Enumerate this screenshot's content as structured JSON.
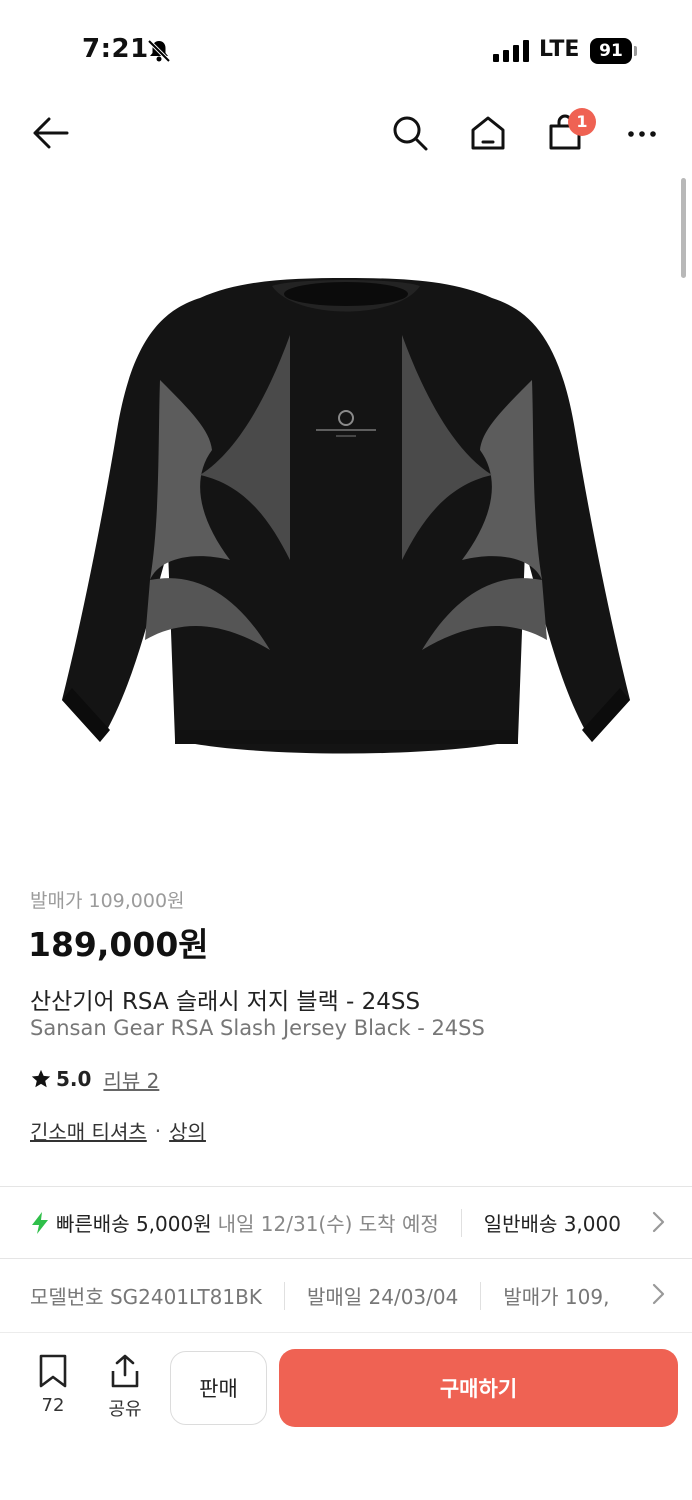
{
  "status_bar": {
    "time": "7:21",
    "network": "LTE",
    "battery": "91",
    "icons": [
      "bell-slash-icon",
      "signal-icon",
      "battery-icon"
    ]
  },
  "nav": {
    "icons": [
      "back-arrow-icon",
      "search-icon",
      "home-icon",
      "shopping-bag-icon",
      "more-icon"
    ],
    "cart_badge": "1"
  },
  "product": {
    "image_desc_icon": "product-jersey-image",
    "release_price": "발매가 109,000원",
    "price": "189,000원",
    "title_ko": "산산기어 RSA 슬래시 저지 블랙 - 24SS",
    "title_en": "Sansan Gear RSA Slash Jersey Black - 24SS",
    "rating": "5.0",
    "review_link": "리뷰 2",
    "category_1": "긴소매 티셔츠",
    "category_sep": "·",
    "category_2": "상의"
  },
  "shipping": {
    "fast_label": "빠른배송 5,000원",
    "fast_eta": "내일 12/31(수) 도착 예정",
    "normal_label": "일반배송 3,000"
  },
  "details": {
    "model": "모델번호 SG2401LT81BK",
    "release_date": "발매일 24/03/04",
    "release_price": "발매가 109,"
  },
  "bottom_bar": {
    "bookmark_count": "72",
    "share_label": "공유",
    "sell_label": "판매",
    "buy_label": "구매하기"
  },
  "colors": {
    "accent": "#ef6253",
    "fast_bolt": "#2fbf4a"
  }
}
